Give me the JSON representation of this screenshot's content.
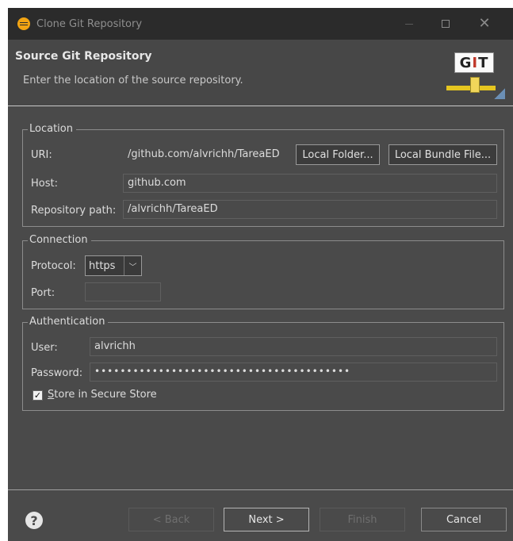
{
  "window": {
    "title": "Clone Git Repository"
  },
  "header": {
    "title": "Source Git Repository",
    "subtitle": "Enter the location of the source repository.",
    "logo_text": "GIT"
  },
  "location": {
    "legend": "Location",
    "uri_label": "URI:",
    "uri_value": "/github.com/alvrichh/TareaED",
    "local_folder_label": "Local Folder...",
    "local_bundle_label": "Local Bundle File...",
    "host_label": "Host:",
    "host_value": "github.com",
    "repo_path_label": "Repository path:",
    "repo_path_value": "/alvrichh/TareaED"
  },
  "connection": {
    "legend": "Connection",
    "protocol_label": "Protocol:",
    "protocol_value": "https",
    "port_label": "Port:",
    "port_value": ""
  },
  "authentication": {
    "legend": "Authentication",
    "user_label": "User:",
    "user_value": "alvrichh",
    "password_label": "Password:",
    "password_value": "••••••••••••••••••••••••••••••••••••••••",
    "store_label": "Store in Secure Store",
    "store_checked": true
  },
  "footer": {
    "back_label": "< Back",
    "next_label": "Next >",
    "finish_label": "Finish",
    "cancel_label": "Cancel"
  }
}
